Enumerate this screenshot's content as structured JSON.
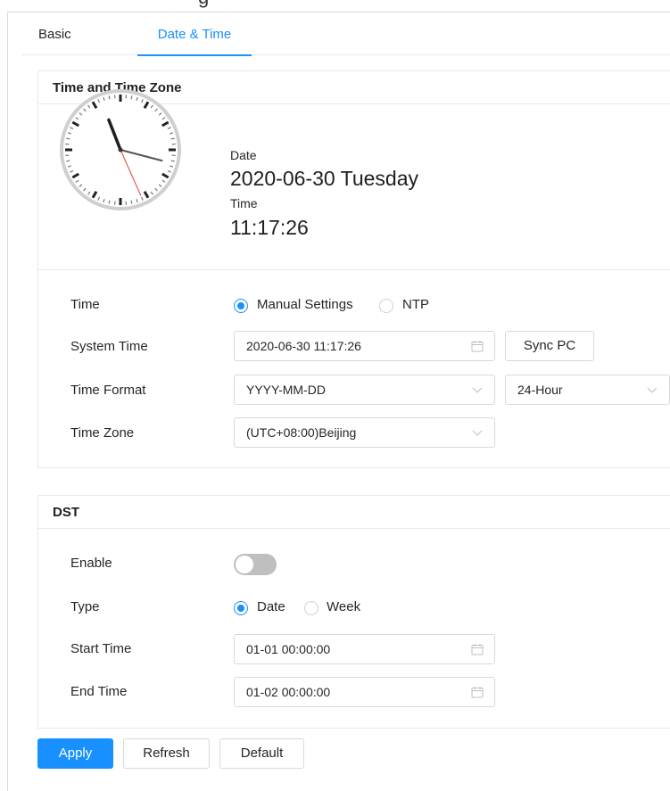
{
  "header": {
    "partial_title": "g"
  },
  "tabs": [
    {
      "label": "Basic",
      "active": false
    },
    {
      "label": "Date & Time",
      "active": true
    }
  ],
  "time_zone_section": {
    "title": "Time and Time Zone",
    "clock": {
      "hours": 11,
      "minutes": 17,
      "seconds": 26
    },
    "date_label": "Date",
    "date_value": "2020-06-30 Tuesday",
    "time_label": "Time",
    "time_value": "11:17:26",
    "time_mode": {
      "label": "Time",
      "options": [
        "Manual Settings",
        "NTP"
      ],
      "selected": "Manual Settings"
    },
    "system_time": {
      "label": "System Time",
      "value": "2020-06-30 11:17:26",
      "sync_label": "Sync PC"
    },
    "time_format": {
      "label": "Time Format",
      "date_format": "YYYY-MM-DD",
      "hour_format": "24-Hour"
    },
    "time_zone": {
      "label": "Time Zone",
      "value": "(UTC+08:00)Beijing"
    }
  },
  "dst_section": {
    "title": "DST",
    "enable": {
      "label": "Enable",
      "on": false
    },
    "type": {
      "label": "Type",
      "options": [
        "Date",
        "Week"
      ],
      "selected": "Date"
    },
    "start_time": {
      "label": "Start Time",
      "value": "01-01 00:00:00"
    },
    "end_time": {
      "label": "End Time",
      "value": "01-02 00:00:00"
    }
  },
  "actions": {
    "apply": "Apply",
    "refresh": "Refresh",
    "default": "Default"
  },
  "colors": {
    "accent": "#1890ff",
    "second_hand": "#e0413b",
    "toggle_off": "#bfbfbf"
  }
}
